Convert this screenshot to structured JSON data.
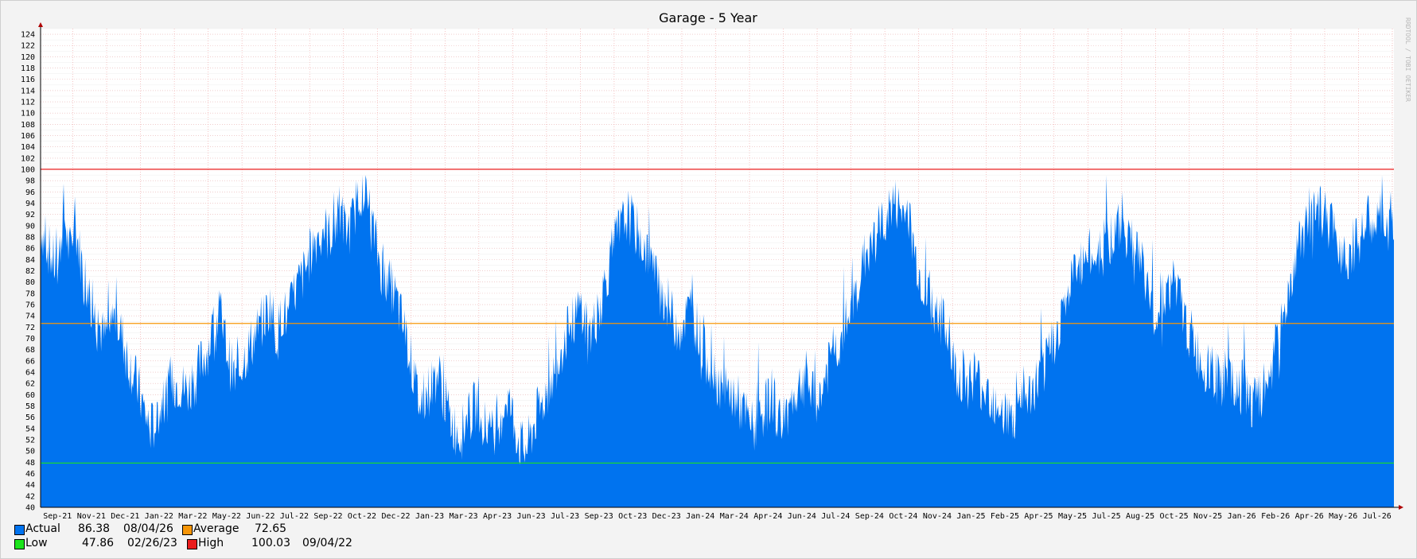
{
  "chart_data": {
    "type": "area",
    "title": "Garage - 5 Year",
    "watermark": "RRDTOOL / TOBI OETIKER",
    "ylim": [
      40,
      125
    ],
    "y_ticks": [
      40,
      42,
      44,
      46,
      48,
      50,
      52,
      54,
      56,
      58,
      60,
      62,
      64,
      66,
      68,
      70,
      72,
      74,
      76,
      78,
      80,
      82,
      84,
      86,
      88,
      90,
      92,
      94,
      96,
      98,
      100,
      102,
      104,
      106,
      108,
      110,
      112,
      114,
      116,
      118,
      120,
      122,
      124
    ],
    "x_ticks": [
      "Sep-21",
      "Nov-21",
      "Dec-21",
      "Jan-22",
      "Mar-22",
      "May-22",
      "Jun-22",
      "Jul-22",
      "Sep-22",
      "Oct-22",
      "Dec-22",
      "Jan-23",
      "Mar-23",
      "Apr-23",
      "Jun-23",
      "Jul-23",
      "Sep-23",
      "Oct-23",
      "Dec-23",
      "Jan-24",
      "Mar-24",
      "Apr-24",
      "Jun-24",
      "Jul-24",
      "Sep-24",
      "Oct-24",
      "Nov-24",
      "Jan-25",
      "Feb-25",
      "Apr-25",
      "May-25",
      "Jul-25",
      "Aug-25",
      "Oct-25",
      "Nov-25",
      "Jan-26",
      "Feb-26",
      "Apr-26",
      "May-26",
      "Jul-26"
    ],
    "grid": true,
    "series": [
      {
        "name": "Actual",
        "color": "#0073ef",
        "values": [
          90,
          87,
          84,
          82,
          93,
          85,
          90,
          84,
          80,
          75,
          73,
          70,
          72,
          74,
          71,
          67,
          64,
          61,
          57,
          54,
          55,
          58,
          60,
          62,
          62,
          61,
          61,
          63,
          66,
          68,
          72,
          75,
          70,
          65,
          62,
          66,
          68,
          70,
          72,
          74,
          76,
          70,
          75,
          73,
          78,
          80,
          82,
          86,
          88,
          90,
          88,
          90,
          92,
          89,
          90,
          95,
          97,
          93,
          88,
          83,
          80,
          79,
          76,
          72,
          68,
          62,
          58,
          60,
          62,
          64,
          60,
          56,
          54,
          53,
          55,
          57,
          59,
          55,
          52,
          54,
          57,
          60,
          56,
          52,
          50,
          52,
          56,
          58,
          61,
          63,
          67,
          70,
          72,
          74,
          76,
          70,
          72,
          75,
          80,
          84,
          88,
          90,
          92,
          90,
          88,
          86,
          84,
          80,
          78,
          76,
          73,
          72,
          74,
          75,
          72,
          68,
          66,
          64,
          62,
          60,
          60,
          59,
          57,
          55,
          54,
          56,
          58,
          60,
          56,
          55,
          58,
          60,
          62,
          63,
          60,
          58,
          62,
          66,
          68,
          70,
          73,
          75,
          80,
          84,
          86,
          88,
          90,
          92,
          94,
          93,
          92,
          90,
          84,
          80,
          78,
          76,
          74,
          72,
          67,
          64,
          63,
          62,
          64,
          62,
          61,
          60,
          59,
          58,
          56,
          55,
          57,
          59,
          60,
          62,
          64,
          66,
          70,
          73,
          76,
          80,
          82,
          84,
          85,
          84,
          86,
          88,
          88,
          89,
          90,
          88,
          87,
          84,
          80,
          76,
          74,
          78,
          79,
          80,
          76,
          72,
          70,
          67,
          65,
          64,
          63,
          62,
          64,
          61,
          60,
          62,
          59,
          58,
          60,
          62,
          66,
          70,
          74,
          80,
          84,
          88,
          90,
          91,
          92,
          92,
          90,
          88,
          86,
          85,
          86,
          88,
          90,
          91,
          90,
          92,
          89,
          90
        ],
        "start_value": 90
      }
    ],
    "hrules": [
      {
        "name": "High",
        "value": 100.03,
        "color": "#ea1c1c"
      },
      {
        "name": "Average",
        "value": 72.65,
        "color": "#f79608"
      },
      {
        "name": "Low",
        "value": 47.86,
        "color": "#1ce41c"
      }
    ]
  },
  "legend": {
    "rows": [
      [
        {
          "label": "Actual",
          "value": "86.38",
          "date": "08/04/26",
          "color": "#0073ef"
        },
        {
          "label": "Average",
          "value": "72.65",
          "date": "",
          "color": "#f79608"
        }
      ],
      [
        {
          "label": "Low",
          "value": "47.86",
          "date": "02/26/23",
          "color": "#1ce41c"
        },
        {
          "label": "High",
          "value": "100.03",
          "date": "09/04/22",
          "color": "#ea1c1c"
        }
      ]
    ]
  }
}
